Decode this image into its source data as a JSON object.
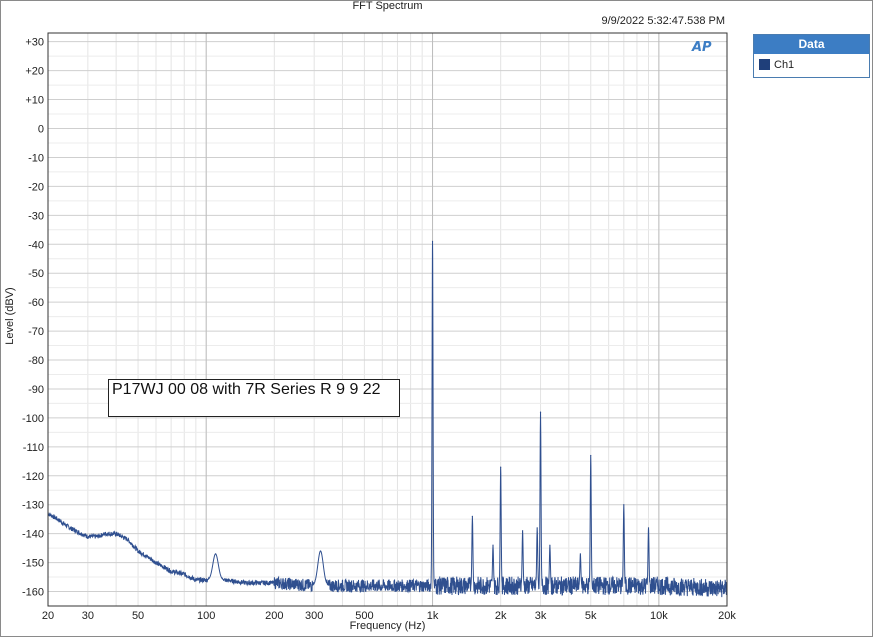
{
  "chart_data": {
    "type": "line",
    "title": "FFT Spectrum",
    "timestamp": "9/9/2022 5:32:47.538 PM",
    "xlabel": "Frequency (Hz)",
    "ylabel": "Level (dBV)",
    "x_scale": "log",
    "xlim": [
      20,
      20000
    ],
    "ylim": [
      -165,
      33
    ],
    "grid": true,
    "legend_position": "right",
    "legend_title": "Data",
    "annotation": "P17WJ 00 08 with 7R Series R 9 9 22",
    "x_ticks": [
      {
        "value": 20,
        "label": "20"
      },
      {
        "value": 30,
        "label": "30"
      },
      {
        "value": 50,
        "label": "50"
      },
      {
        "value": 100,
        "label": "100"
      },
      {
        "value": 200,
        "label": "200"
      },
      {
        "value": 300,
        "label": "300"
      },
      {
        "value": 500,
        "label": "500"
      },
      {
        "value": 1000,
        "label": "1k"
      },
      {
        "value": 2000,
        "label": "2k"
      },
      {
        "value": 3000,
        "label": "3k"
      },
      {
        "value": 5000,
        "label": "5k"
      },
      {
        "value": 10000,
        "label": "10k"
      },
      {
        "value": 20000,
        "label": "20k"
      }
    ],
    "y_ticks": [
      {
        "value": 30,
        "label": "+30"
      },
      {
        "value": 20,
        "label": "+20"
      },
      {
        "value": 10,
        "label": "+10"
      },
      {
        "value": 0,
        "label": "0"
      },
      {
        "value": -10,
        "label": "-10"
      },
      {
        "value": -20,
        "label": "-20"
      },
      {
        "value": -30,
        "label": "-30"
      },
      {
        "value": -40,
        "label": "-40"
      },
      {
        "value": -50,
        "label": "-50"
      },
      {
        "value": -60,
        "label": "-60"
      },
      {
        "value": -70,
        "label": "-70"
      },
      {
        "value": -80,
        "label": "-80"
      },
      {
        "value": -90,
        "label": "-90"
      },
      {
        "value": -100,
        "label": "-100"
      },
      {
        "value": -110,
        "label": "-110"
      },
      {
        "value": -120,
        "label": "-120"
      },
      {
        "value": -130,
        "label": "-130"
      },
      {
        "value": -140,
        "label": "-140"
      },
      {
        "value": -150,
        "label": "-150"
      },
      {
        "value": -160,
        "label": "-160"
      }
    ],
    "series": [
      {
        "name": "Ch1",
        "color": "#2f4f8f",
        "noise_floor": [
          [
            20,
            -133
          ],
          [
            22,
            -135
          ],
          [
            25,
            -138
          ],
          [
            28,
            -140
          ],
          [
            30,
            -141
          ],
          [
            33,
            -141
          ],
          [
            36,
            -140
          ],
          [
            40,
            -140
          ],
          [
            45,
            -142
          ],
          [
            50,
            -146
          ],
          [
            55,
            -148
          ],
          [
            60,
            -150
          ],
          [
            70,
            -153
          ],
          [
            80,
            -154
          ],
          [
            90,
            -156
          ],
          [
            100,
            -156
          ],
          [
            120,
            -156
          ],
          [
            150,
            -157
          ],
          [
            200,
            -157
          ],
          [
            300,
            -158
          ],
          [
            500,
            -158
          ],
          [
            1000,
            -158
          ],
          [
            2000,
            -158
          ],
          [
            5000,
            -158
          ],
          [
            10000,
            -158
          ],
          [
            20000,
            -159
          ]
        ],
        "peaks": [
          {
            "x": 110,
            "y": -147
          },
          {
            "x": 320,
            "y": -146
          },
          {
            "x": 1000,
            "y": -39
          },
          {
            "x": 1500,
            "y": -134
          },
          {
            "x": 1850,
            "y": -144
          },
          {
            "x": 2000,
            "y": -117
          },
          {
            "x": 2500,
            "y": -139
          },
          {
            "x": 2900,
            "y": -138
          },
          {
            "x": 3000,
            "y": -98
          },
          {
            "x": 3300,
            "y": -144
          },
          {
            "x": 4500,
            "y": -147
          },
          {
            "x": 5000,
            "y": -113
          },
          {
            "x": 7000,
            "y": -130
          },
          {
            "x": 9000,
            "y": -138
          }
        ]
      }
    ]
  }
}
